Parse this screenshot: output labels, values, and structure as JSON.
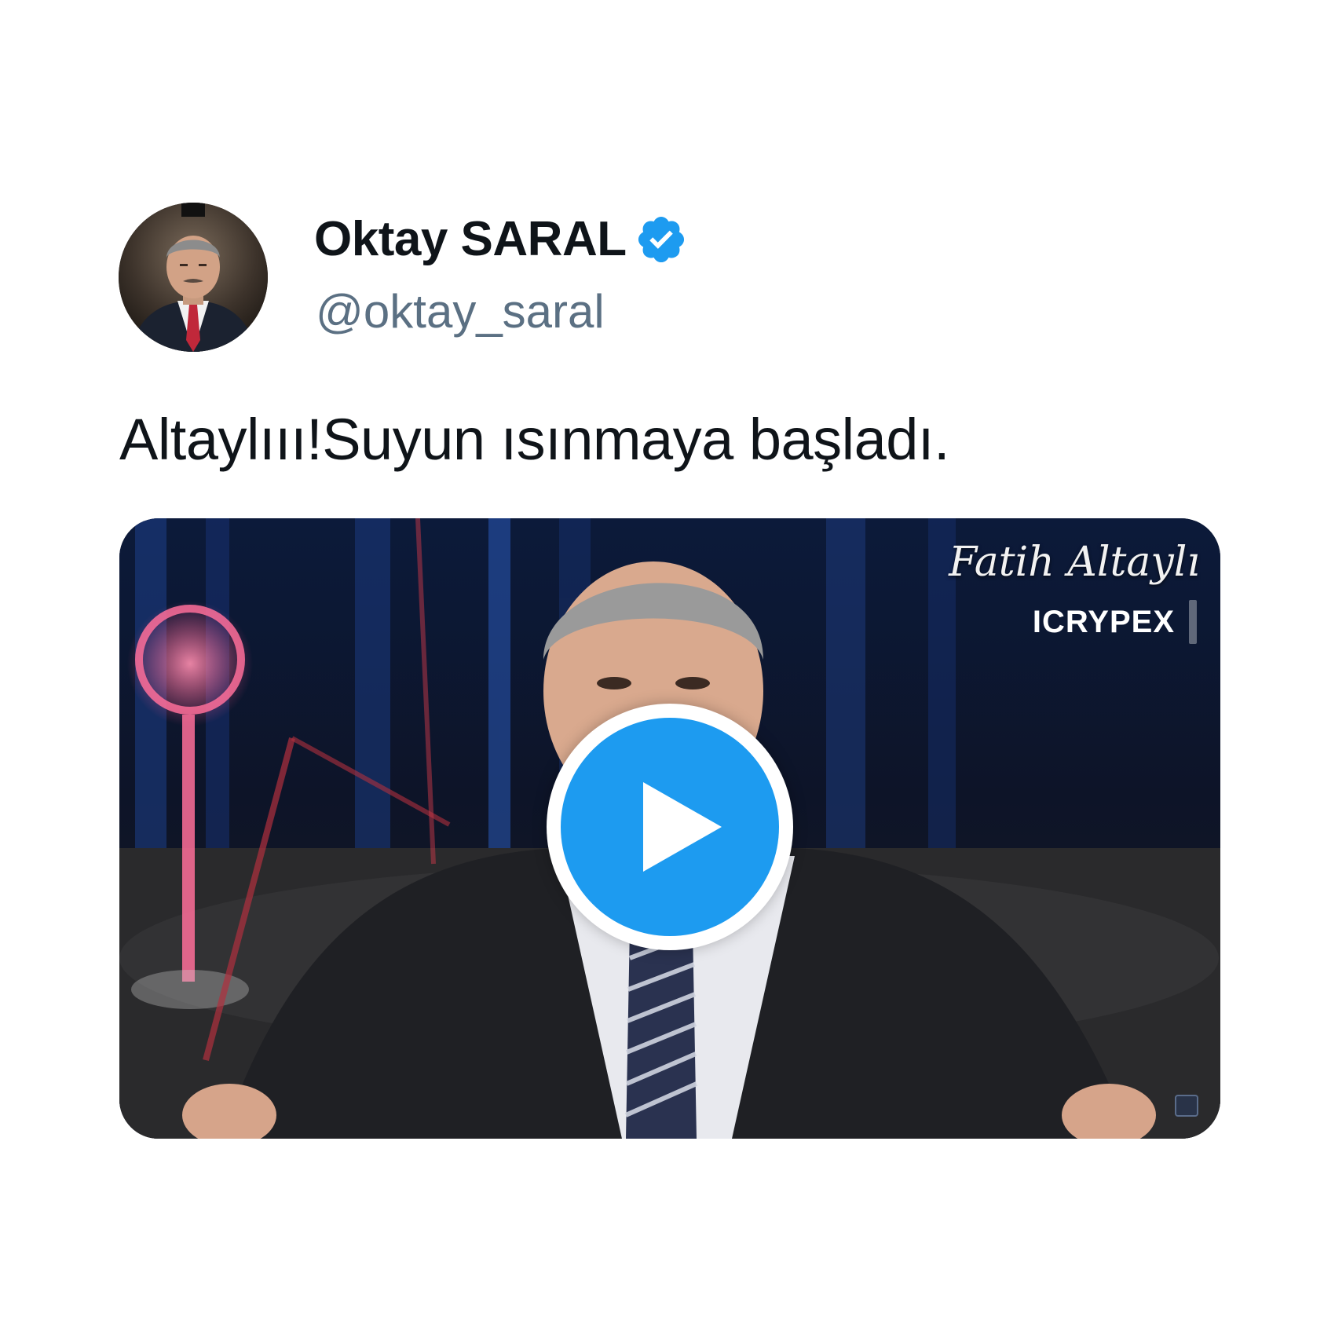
{
  "tweet": {
    "author": {
      "display_name": "Oktay SARAL",
      "handle": "@oktay_saral",
      "verified": true,
      "avatar_icon": "profile-photo"
    },
    "text": "Altaylııı!Suyun ısınmaya başladı.",
    "media": {
      "type": "video",
      "overlay_title": "Fatih Altaylı",
      "overlay_brand": "ICRYPEX",
      "play_icon": "play-icon"
    }
  },
  "colors": {
    "accent": "#1d9bf0",
    "text_primary": "#0f1419",
    "text_secondary": "#5b7083",
    "background": "#ffffff"
  }
}
